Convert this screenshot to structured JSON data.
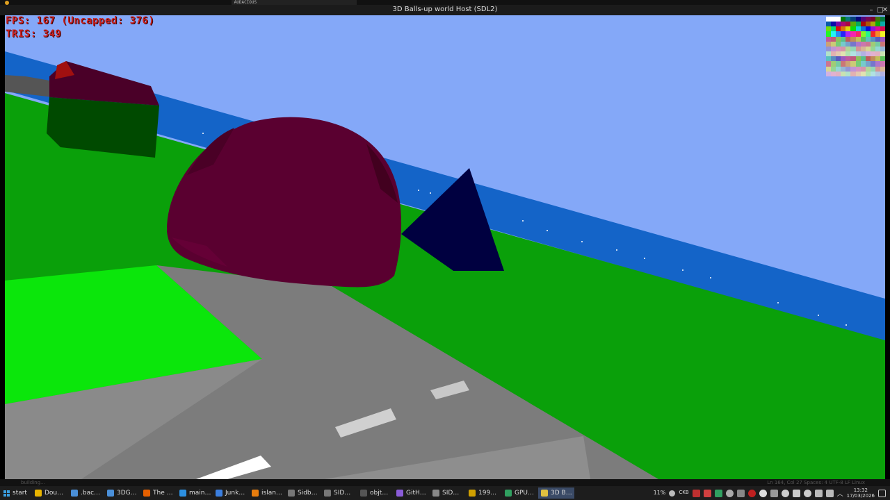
{
  "top_strip": {
    "audacious_label": "AUDACIOUS"
  },
  "window": {
    "title": "3D Balls-up world Host (SDL2)",
    "minimize_label": "–",
    "maximize_label": "□",
    "close_label": "✕"
  },
  "hud": {
    "fps_text": "FPS: 167 (Uncapped: 376)",
    "tris_text": "TRIS: 349"
  },
  "statusline": {
    "left_text": "building...",
    "right_text": "Ln 164, Col 27   Spaces: 4   UTF-8   LF   Linux"
  },
  "taskbar": {
    "start_label": "start",
    "tasks": [
      {
        "label": "Dou…",
        "icon": "chrome-icon",
        "color": "#e8b400"
      },
      {
        "label": ".bac…",
        "icon": "explorer-icon",
        "color": "#4a8fd8"
      },
      {
        "label": "3DG…",
        "icon": "explorer-icon",
        "color": "#4a8fd8"
      },
      {
        "label": "The …",
        "icon": "firefox-icon",
        "color": "#e66000"
      },
      {
        "label": "main…",
        "icon": "vscode-icon",
        "color": "#2c8fe0"
      },
      {
        "label": "Junk…",
        "icon": "browser-icon",
        "color": "#3b7fe0"
      },
      {
        "label": "islan…",
        "icon": "blender-icon",
        "color": "#e87d0d"
      },
      {
        "label": "Sidb…",
        "icon": "terminal-icon",
        "color": "#777777"
      },
      {
        "label": "SID…",
        "icon": "terminal-icon",
        "color": "#777777"
      },
      {
        "label": "objt…",
        "icon": "console-icon",
        "color": "#555555"
      },
      {
        "label": "GitH…",
        "icon": "github-icon",
        "color": "#8a5cd8"
      },
      {
        "label": "SID…",
        "icon": "terminal-icon",
        "color": "#888888"
      },
      {
        "label": "199…",
        "icon": "audio-icon",
        "color": "#d0a000"
      },
      {
        "label": "GPU…",
        "icon": "gpu-icon",
        "color": "#30a060"
      },
      {
        "label": "3D B…",
        "icon": "app-icon",
        "color": "#e0c040",
        "active": true
      }
    ],
    "tray_percent": "11%",
    "tray_keyboard": "CKB",
    "clock_time": "13:32",
    "clock_date": "17/03/2026"
  },
  "colors": {
    "sky": "#84a8f8",
    "sea": "#1464c8",
    "grass": "#0aa00a",
    "bright_grass": "#0be60b",
    "road": "#7c7c7c",
    "dome": "#5a0030",
    "pyramid": "#000040",
    "hud_text": "#c8201e"
  }
}
